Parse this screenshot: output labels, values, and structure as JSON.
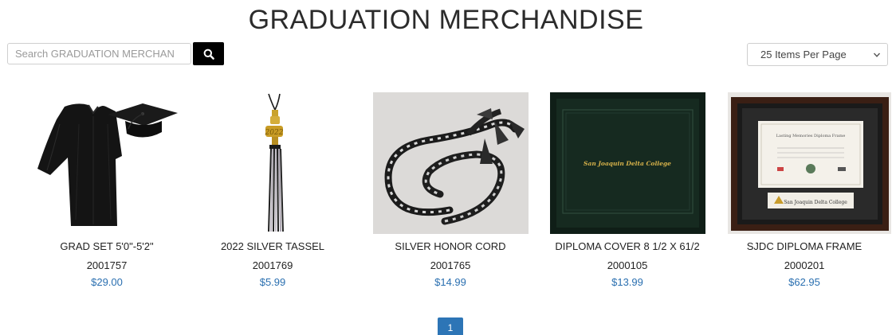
{
  "page": {
    "title": "GRADUATION MERCHANDISE"
  },
  "search": {
    "placeholder": "Search GRADUATION MERCHAN",
    "icon": "search-icon"
  },
  "per_page": {
    "selected": "25 Items Per Page"
  },
  "products": [
    {
      "name": "GRAD SET 5'0\"-5'2\"",
      "sku": "2001757",
      "price": "$29.00"
    },
    {
      "name": "2022 SILVER TASSEL",
      "sku": "2001769",
      "price": "$5.99"
    },
    {
      "name": "SILVER HONOR CORD",
      "sku": "2001765",
      "price": "$14.99"
    },
    {
      "name": "DIPLOMA COVER 8 1/2 X 61/2",
      "sku": "2000105",
      "price": "$13.99"
    },
    {
      "name": "SJDC DIPLOMA FRAME",
      "sku": "2000201",
      "price": "$62.95"
    }
  ],
  "images": {
    "tassel_year": "2022",
    "cover_text": "San Joaquin Delta College",
    "frame_title": "Lasting Memories Diploma Frame",
    "frame_college": "San Joaquin Delta College"
  },
  "pagination": {
    "current": "1"
  },
  "colors": {
    "accent": "#2d75b6",
    "price": "#2a6fb0"
  }
}
